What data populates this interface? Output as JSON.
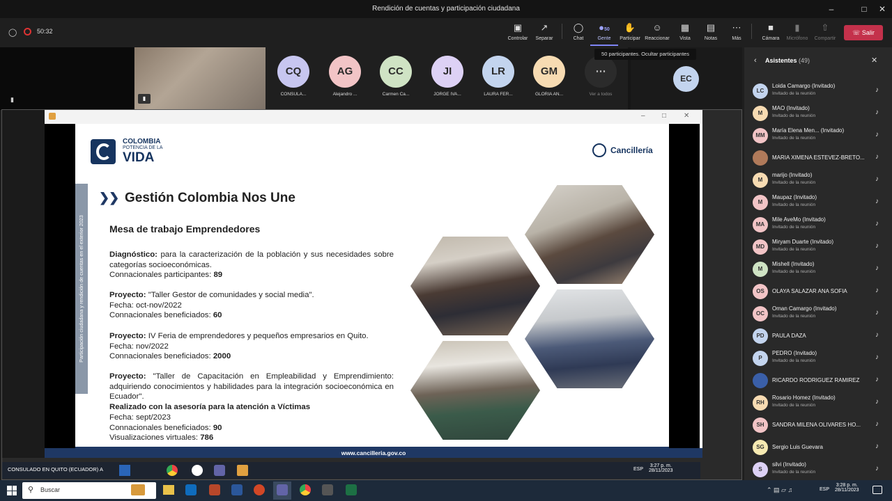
{
  "window": {
    "title": "Rendición de cuentas y participación ciudadana"
  },
  "meeting": {
    "timer": "50:32",
    "people_count": "50",
    "tooltip": "50 participantes. Ocultar participantes"
  },
  "toolbar": [
    {
      "label": "Controlar",
      "icon": "screen-icon"
    },
    {
      "label": "Separar",
      "icon": "popout-icon"
    },
    {
      "label": "Chat",
      "icon": "chat-icon"
    },
    {
      "label": "Gente",
      "icon": "people-icon"
    },
    {
      "label": "Participar",
      "icon": "hand-icon"
    },
    {
      "label": "Reaccionar",
      "icon": "smile-icon"
    },
    {
      "label": "Vista",
      "icon": "grid-icon"
    },
    {
      "label": "Notas",
      "icon": "notes-icon"
    },
    {
      "label": "Más",
      "icon": "more-icon"
    },
    {
      "label": "Cámara",
      "icon": "camera-icon"
    },
    {
      "label": "Micrófono",
      "icon": "mic-icon"
    },
    {
      "label": "Compartir",
      "icon": "share-icon"
    }
  ],
  "leave_label": "Salir",
  "participants_strip": [
    {
      "initials": "CQ",
      "name": "CONSULA...",
      "color": "#c7c6f0"
    },
    {
      "initials": "AG",
      "name": "Alejandro ...",
      "color": "#f2c4c6"
    },
    {
      "initials": "CC",
      "name": "Carmen Ca...",
      "color": "#cfe3c4"
    },
    {
      "initials": "JI",
      "name": "JORGE IVA...",
      "color": "#ddd1f5"
    },
    {
      "initials": "LR",
      "name": "LAURA FER...",
      "color": "#c3d4ee"
    },
    {
      "initials": "GM",
      "name": "GLORIA AN...",
      "color": "#f7dbb2"
    }
  ],
  "see_all": "Ver a todos",
  "self_initials": "EC",
  "slide": {
    "logo_line1": "COLOMBIA",
    "logo_line2": "POTENCIA DE LA",
    "logo_line3": "VIDA",
    "cancilleria": "Cancillería",
    "side_text": "Participación ciudadana y rendición de cuentas en el exterior 2023",
    "title": "Gestión Colombia Nos Une",
    "subtitle": "Mesa de trabajo Emprendedores",
    "diag_label": "Diagnóstico:",
    "diag_text": " para la caracterización de la población y sus necesidades sobre categorías socioeconómicas.",
    "diag_count_label": "Connacionales participantes: ",
    "diag_count": "89",
    "p1_label": "Proyecto:",
    "p1_text": " \"Taller Gestor de comunidades y social media\".",
    "p1_date": "Fecha: oct-nov/2022",
    "p1_count_label": "Connacionales beneficiados: ",
    "p1_count": "60",
    "p2_label": "Proyecto:",
    "p2_text": " IV Feria de emprendedores y pequeños empresarios en Quito.",
    "p2_date": "Fecha: nov/2022",
    "p2_count_label": "Connacionales beneficiados: ",
    "p2_count": "2000",
    "p3_label": "Proyecto:",
    "p3_text": " \"Taller de Capacitación en Empleabilidad y Emprendimiento: adquiriendo conocimientos y habilidades para la integración socioeconómica en Ecuador\".",
    "p3_bold": "Realizado con la asesoría para la atención a Víctimas",
    "p3_date": "Fecha: sept/2023",
    "p3_count_label": "Connacionales beneficiados: ",
    "p3_count": "90",
    "p3_views_label": "Visualizaciones virtuales: ",
    "p3_views": "786",
    "footer": "www.cancilleria.gov.co"
  },
  "remote_taskbar": {
    "app_label": "CONSULADO EN QUITO (ECUADOR) A",
    "lang": "ESP",
    "time": "3:27 p. m.",
    "date": "28/11/2023"
  },
  "sidebar": {
    "title": "Asistentes",
    "count": "(49)"
  },
  "attendees": [
    {
      "initials": "LC",
      "name": "Loida Camargo (Invitado)",
      "role": "Invitado de la reunión",
      "color": "#c3d4ee"
    },
    {
      "initials": "M",
      "name": "MAO (Invitado)",
      "role": "Invitado de la reunión",
      "color": "#f7dbb2"
    },
    {
      "initials": "MM",
      "name": "María Elena Men... (Invitado)",
      "role": "Invitado de la reunión",
      "color": "#f2c4c6"
    },
    {
      "initials": "",
      "name": "MARIA XIMENA ESTEVEZ-BRETO...",
      "role": "",
      "color": "#b07a5a"
    },
    {
      "initials": "M",
      "name": "marijo (Invitado)",
      "role": "Invitado de la reunión",
      "color": "#f7dbb2"
    },
    {
      "initials": "M",
      "name": "Maupaz (Invitado)",
      "role": "Invitado de la reunión",
      "color": "#f2c4c6"
    },
    {
      "initials": "MA",
      "name": "Mile AveMo (Invitado)",
      "role": "Invitado de la reunión",
      "color": "#f2c4c6"
    },
    {
      "initials": "MD",
      "name": "Miryam Duarte (Invitado)",
      "role": "Invitado de la reunión",
      "color": "#f2c4c6"
    },
    {
      "initials": "M",
      "name": "Mishell (Invitado)",
      "role": "Invitado de la reunión",
      "color": "#cfe3c4"
    },
    {
      "initials": "OS",
      "name": "OLAYA SALAZAR ANA SOFIA",
      "role": "",
      "color": "#f2c4c6"
    },
    {
      "initials": "OC",
      "name": "Oman Camargo (Invitado)",
      "role": "Invitado de la reunión",
      "color": "#f2c4c6"
    },
    {
      "initials": "PD",
      "name": "PAULA DAZA",
      "role": "",
      "color": "#c3d4ee"
    },
    {
      "initials": "P",
      "name": "PEDRO (Invitado)",
      "role": "Invitado de la reunión",
      "color": "#c3d4ee"
    },
    {
      "initials": "",
      "name": "RICARDO RODRIGUEZ RAMIREZ",
      "role": "",
      "color": "#3a5fa8"
    },
    {
      "initials": "RH",
      "name": "Rosario Homez (Invitado)",
      "role": "Invitado de la reunión",
      "color": "#f7dbb2"
    },
    {
      "initials": "SH",
      "name": "SANDRA MILENA OLIVARES HO...",
      "role": "",
      "color": "#f2c4c6"
    },
    {
      "initials": "SG",
      "name": "Sergio Luis Guevara",
      "role": "",
      "color": "#f7eab2"
    },
    {
      "initials": "S",
      "name": "silvi (Invitado)",
      "role": "Invitado de la reunión",
      "color": "#ddd1f5"
    }
  ],
  "taskbar": {
    "search_placeholder": "Buscar",
    "lang": "ESP",
    "time": "3:28 p. m.",
    "date": "28/11/2023"
  }
}
